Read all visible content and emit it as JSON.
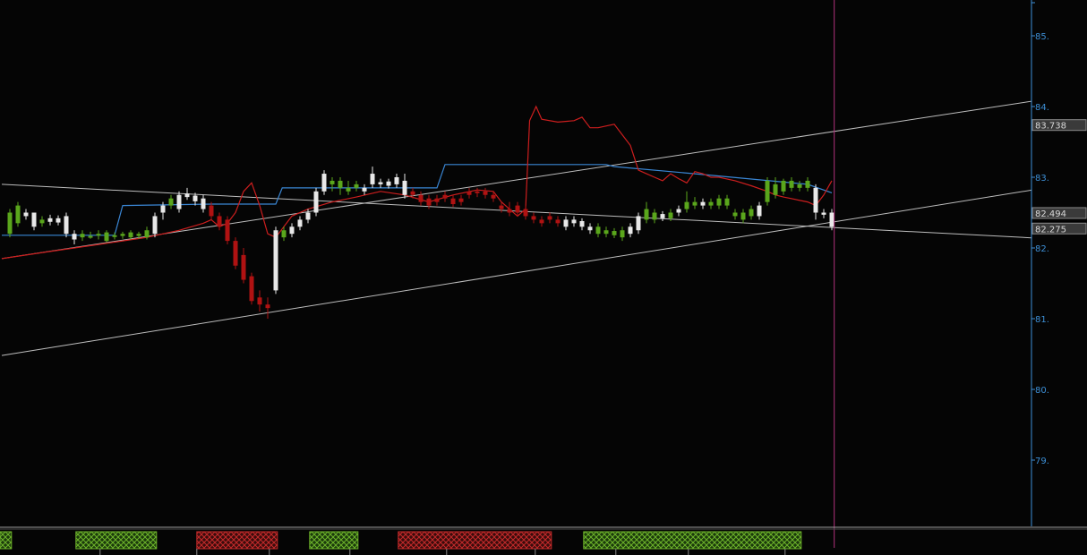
{
  "chart_data": {
    "type": "candlestick",
    "y_axis": {
      "side": "right",
      "ylim": [
        78.1,
        85.5
      ],
      "ticks": [
        {
          "value": 85,
          "label": "85."
        },
        {
          "value": 84,
          "label": "84."
        },
        {
          "value": 83,
          "label": "83."
        },
        {
          "value": 82,
          "label": "82."
        },
        {
          "value": 81,
          "label": "81."
        },
        {
          "value": 80,
          "label": "80."
        },
        {
          "value": 79,
          "label": "79."
        }
      ]
    },
    "grid": false,
    "colors": {
      "background": "#050505",
      "up_candle": "#5aa61c",
      "down_candle": "#b01212",
      "neutral_candle": "#e8e8e8",
      "red_line": "#cc1e1e",
      "blue_line": "#3a86d4",
      "trendline": "#bdbdbd",
      "cursor_line": "#b0307c",
      "axis_text": "#3d8fd6",
      "green_zone": "#6db32a",
      "red_zone": "#c42a2a"
    },
    "price_tags": [
      {
        "label": "83.738",
        "value": 83.738
      },
      {
        "label": "82.494",
        "value": 82.494
      },
      {
        "label": "82.3",
        "value": 82.3,
        "highlight": true
      },
      {
        "label": "82.275",
        "value": 82.275
      }
    ],
    "candles": [
      {
        "t": 1,
        "o": 82.2,
        "h": 82.55,
        "l": 82.15,
        "c": 82.5,
        "k": "g"
      },
      {
        "t": 2,
        "o": 82.6,
        "h": 82.65,
        "l": 82.3,
        "c": 82.35,
        "k": "g"
      },
      {
        "t": 3,
        "o": 82.5,
        "h": 82.55,
        "l": 82.4,
        "c": 82.45,
        "k": "w"
      },
      {
        "t": 4,
        "o": 82.3,
        "h": 82.5,
        "l": 82.25,
        "c": 82.5,
        "k": "w"
      },
      {
        "t": 5,
        "o": 82.35,
        "h": 82.45,
        "l": 82.3,
        "c": 82.4,
        "k": "g"
      },
      {
        "t": 6,
        "o": 82.37,
        "h": 82.47,
        "l": 82.32,
        "c": 82.42,
        "k": "w"
      },
      {
        "t": 7,
        "o": 82.36,
        "h": 82.46,
        "l": 82.32,
        "c": 82.42,
        "k": "w"
      },
      {
        "t": 8,
        "o": 82.2,
        "h": 82.5,
        "l": 82.15,
        "c": 82.45,
        "k": "w"
      },
      {
        "t": 9,
        "o": 82.2,
        "h": 82.25,
        "l": 82.05,
        "c": 82.12,
        "k": "w"
      },
      {
        "t": 10,
        "o": 82.15,
        "h": 82.25,
        "l": 82.1,
        "c": 82.2,
        "k": "g"
      },
      {
        "t": 11,
        "o": 82.17,
        "h": 82.23,
        "l": 82.13,
        "c": 82.17,
        "k": "g"
      },
      {
        "t": 12,
        "o": 82.18,
        "h": 82.25,
        "l": 82.12,
        "c": 82.2,
        "k": "g"
      },
      {
        "t": 13,
        "o": 82.1,
        "h": 82.25,
        "l": 82.08,
        "c": 82.22,
        "k": "g"
      },
      {
        "t": 14,
        "o": 82.16,
        "h": 82.22,
        "l": 82.12,
        "c": 82.18,
        "k": "g"
      },
      {
        "t": 15,
        "o": 82.17,
        "h": 82.23,
        "l": 82.13,
        "c": 82.2,
        "k": "g"
      },
      {
        "t": 16,
        "o": 82.15,
        "h": 82.25,
        "l": 82.12,
        "c": 82.22,
        "k": "g"
      },
      {
        "t": 17,
        "o": 82.17,
        "h": 82.23,
        "l": 82.13,
        "c": 82.2,
        "k": "g"
      },
      {
        "t": 18,
        "o": 82.15,
        "h": 82.3,
        "l": 82.12,
        "c": 82.25,
        "k": "g"
      },
      {
        "t": 19,
        "o": 82.2,
        "h": 82.5,
        "l": 82.15,
        "c": 82.45,
        "k": "w"
      },
      {
        "t": 20,
        "o": 82.5,
        "h": 82.65,
        "l": 82.4,
        "c": 82.6,
        "k": "w"
      },
      {
        "t": 21,
        "o": 82.6,
        "h": 82.75,
        "l": 82.55,
        "c": 82.7,
        "k": "g"
      },
      {
        "t": 22,
        "o": 82.55,
        "h": 82.8,
        "l": 82.5,
        "c": 82.75,
        "k": "w"
      },
      {
        "t": 23,
        "o": 82.72,
        "h": 82.85,
        "l": 82.68,
        "c": 82.77,
        "k": "w"
      },
      {
        "t": 24,
        "o": 82.74,
        "h": 82.78,
        "l": 82.6,
        "c": 82.66,
        "k": "w"
      },
      {
        "t": 25,
        "o": 82.7,
        "h": 82.75,
        "l": 82.5,
        "c": 82.55,
        "k": "w"
      },
      {
        "t": 26,
        "o": 82.6,
        "h": 82.65,
        "l": 82.4,
        "c": 82.45,
        "k": "r"
      },
      {
        "t": 27,
        "o": 82.45,
        "h": 82.5,
        "l": 82.25,
        "c": 82.3,
        "k": "r"
      },
      {
        "t": 28,
        "o": 82.4,
        "h": 82.45,
        "l": 82.05,
        "c": 82.1,
        "k": "r"
      },
      {
        "t": 29,
        "o": 82.1,
        "h": 82.15,
        "l": 81.7,
        "c": 81.75,
        "k": "r"
      },
      {
        "t": 30,
        "o": 81.9,
        "h": 82.0,
        "l": 81.5,
        "c": 81.55,
        "k": "r"
      },
      {
        "t": 31,
        "o": 81.6,
        "h": 81.65,
        "l": 81.2,
        "c": 81.25,
        "k": "r"
      },
      {
        "t": 32,
        "o": 81.3,
        "h": 81.4,
        "l": 81.1,
        "c": 81.2,
        "k": "r"
      },
      {
        "t": 33,
        "o": 81.2,
        "h": 81.3,
        "l": 81.0,
        "c": 81.15,
        "k": "r"
      },
      {
        "t": 34,
        "o": 81.4,
        "h": 82.3,
        "l": 81.35,
        "c": 82.25,
        "k": "w"
      },
      {
        "t": 35,
        "o": 82.15,
        "h": 82.3,
        "l": 82.1,
        "c": 82.25,
        "k": "g"
      },
      {
        "t": 36,
        "o": 82.2,
        "h": 82.35,
        "l": 82.15,
        "c": 82.3,
        "k": "w"
      },
      {
        "t": 37,
        "o": 82.3,
        "h": 82.45,
        "l": 82.25,
        "c": 82.4,
        "k": "w"
      },
      {
        "t": 38,
        "o": 82.4,
        "h": 82.55,
        "l": 82.35,
        "c": 82.5,
        "k": "w"
      },
      {
        "t": 39,
        "o": 82.5,
        "h": 82.85,
        "l": 82.45,
        "c": 82.8,
        "k": "w"
      },
      {
        "t": 40,
        "o": 82.8,
        "h": 83.1,
        "l": 82.75,
        "c": 83.05,
        "k": "w"
      },
      {
        "t": 41,
        "o": 82.9,
        "h": 83.0,
        "l": 82.8,
        "c": 82.95,
        "k": "g"
      },
      {
        "t": 42,
        "o": 82.85,
        "h": 83.0,
        "l": 82.75,
        "c": 82.95,
        "k": "g"
      },
      {
        "t": 43,
        "o": 82.8,
        "h": 82.95,
        "l": 82.75,
        "c": 82.85,
        "k": "g"
      },
      {
        "t": 44,
        "o": 82.85,
        "h": 82.95,
        "l": 82.8,
        "c": 82.9,
        "k": "g"
      },
      {
        "t": 45,
        "o": 82.8,
        "h": 82.9,
        "l": 82.75,
        "c": 82.85,
        "k": "w"
      },
      {
        "t": 46,
        "o": 82.9,
        "h": 83.15,
        "l": 82.85,
        "c": 83.05,
        "k": "w"
      },
      {
        "t": 47,
        "o": 82.9,
        "h": 82.98,
        "l": 82.85,
        "c": 82.93,
        "k": "w"
      },
      {
        "t": 48,
        "o": 82.88,
        "h": 82.98,
        "l": 82.84,
        "c": 82.94,
        "k": "w"
      },
      {
        "t": 49,
        "o": 82.9,
        "h": 83.05,
        "l": 82.85,
        "c": 83.0,
        "k": "w"
      },
      {
        "t": 50,
        "o": 82.95,
        "h": 83.05,
        "l": 82.7,
        "c": 82.75,
        "k": "w"
      },
      {
        "t": 51,
        "o": 82.8,
        "h": 82.85,
        "l": 82.7,
        "c": 82.75,
        "k": "r"
      },
      {
        "t": 52,
        "o": 82.75,
        "h": 82.8,
        "l": 82.6,
        "c": 82.65,
        "k": "r"
      },
      {
        "t": 53,
        "o": 82.7,
        "h": 82.75,
        "l": 82.55,
        "c": 82.6,
        "k": "r"
      },
      {
        "t": 54,
        "o": 82.7,
        "h": 82.75,
        "l": 82.6,
        "c": 82.65,
        "k": "r"
      },
      {
        "t": 55,
        "o": 82.75,
        "h": 82.8,
        "l": 82.65,
        "c": 82.7,
        "k": "r"
      },
      {
        "t": 56,
        "o": 82.7,
        "h": 82.75,
        "l": 82.58,
        "c": 82.62,
        "k": "r"
      },
      {
        "t": 57,
        "o": 82.65,
        "h": 82.75,
        "l": 82.6,
        "c": 82.7,
        "k": "r"
      },
      {
        "t": 58,
        "o": 82.75,
        "h": 82.85,
        "l": 82.7,
        "c": 82.8,
        "k": "r"
      },
      {
        "t": 59,
        "o": 82.78,
        "h": 82.85,
        "l": 82.72,
        "c": 82.8,
        "k": "r"
      },
      {
        "t": 60,
        "o": 82.8,
        "h": 82.85,
        "l": 82.7,
        "c": 82.75,
        "k": "r"
      },
      {
        "t": 61,
        "o": 82.75,
        "h": 82.8,
        "l": 82.65,
        "c": 82.7,
        "k": "r"
      },
      {
        "t": 62,
        "o": 82.6,
        "h": 82.65,
        "l": 82.5,
        "c": 82.55,
        "k": "r"
      },
      {
        "t": 63,
        "o": 82.55,
        "h": 82.65,
        "l": 82.45,
        "c": 82.5,
        "k": "r"
      },
      {
        "t": 64,
        "o": 82.6,
        "h": 82.65,
        "l": 82.45,
        "c": 82.5,
        "k": "r"
      },
      {
        "t": 65,
        "o": 82.55,
        "h": 82.6,
        "l": 82.4,
        "c": 82.45,
        "k": "r"
      },
      {
        "t": 66,
        "o": 82.45,
        "h": 82.5,
        "l": 82.35,
        "c": 82.4,
        "k": "r"
      },
      {
        "t": 67,
        "o": 82.4,
        "h": 82.45,
        "l": 82.3,
        "c": 82.35,
        "k": "r"
      },
      {
        "t": 68,
        "o": 82.4,
        "h": 82.5,
        "l": 82.35,
        "c": 82.45,
        "k": "r"
      },
      {
        "t": 69,
        "o": 82.35,
        "h": 82.45,
        "l": 82.3,
        "c": 82.4,
        "k": "r"
      },
      {
        "t": 70,
        "o": 82.3,
        "h": 82.45,
        "l": 82.25,
        "c": 82.4,
        "k": "w"
      },
      {
        "t": 71,
        "o": 82.35,
        "h": 82.45,
        "l": 82.3,
        "c": 82.4,
        "k": "w"
      },
      {
        "t": 72,
        "o": 82.3,
        "h": 82.42,
        "l": 82.25,
        "c": 82.38,
        "k": "w"
      },
      {
        "t": 73,
        "o": 82.25,
        "h": 82.35,
        "l": 82.2,
        "c": 82.3,
        "k": "w"
      },
      {
        "t": 74,
        "o": 82.3,
        "h": 82.35,
        "l": 82.15,
        "c": 82.2,
        "k": "g"
      },
      {
        "t": 75,
        "o": 82.2,
        "h": 82.3,
        "l": 82.15,
        "c": 82.25,
        "k": "g"
      },
      {
        "t": 76,
        "o": 82.18,
        "h": 82.28,
        "l": 82.14,
        "c": 82.24,
        "k": "g"
      },
      {
        "t": 77,
        "o": 82.15,
        "h": 82.3,
        "l": 82.1,
        "c": 82.25,
        "k": "g"
      },
      {
        "t": 78,
        "o": 82.2,
        "h": 82.35,
        "l": 82.15,
        "c": 82.3,
        "k": "w"
      },
      {
        "t": 79,
        "o": 82.25,
        "h": 82.5,
        "l": 82.2,
        "c": 82.45,
        "k": "w"
      },
      {
        "t": 80,
        "o": 82.4,
        "h": 82.65,
        "l": 82.35,
        "c": 82.55,
        "k": "g"
      },
      {
        "t": 81,
        "o": 82.4,
        "h": 82.55,
        "l": 82.35,
        "c": 82.5,
        "k": "g"
      },
      {
        "t": 82,
        "o": 82.42,
        "h": 82.52,
        "l": 82.38,
        "c": 82.48,
        "k": "w"
      },
      {
        "t": 83,
        "o": 82.42,
        "h": 82.55,
        "l": 82.38,
        "c": 82.5,
        "k": "g"
      },
      {
        "t": 84,
        "o": 82.5,
        "h": 82.6,
        "l": 82.45,
        "c": 82.55,
        "k": "w"
      },
      {
        "t": 85,
        "o": 82.55,
        "h": 82.8,
        "l": 82.5,
        "c": 82.65,
        "k": "g"
      },
      {
        "t": 86,
        "o": 82.6,
        "h": 82.72,
        "l": 82.55,
        "c": 82.65,
        "k": "g"
      },
      {
        "t": 87,
        "o": 82.6,
        "h": 82.7,
        "l": 82.55,
        "c": 82.65,
        "k": "w"
      },
      {
        "t": 88,
        "o": 82.6,
        "h": 82.7,
        "l": 82.55,
        "c": 82.65,
        "k": "g"
      },
      {
        "t": 89,
        "o": 82.6,
        "h": 82.75,
        "l": 82.55,
        "c": 82.7,
        "k": "g"
      },
      {
        "t": 90,
        "o": 82.7,
        "h": 82.75,
        "l": 82.55,
        "c": 82.6,
        "k": "g"
      },
      {
        "t": 91,
        "o": 82.5,
        "h": 82.55,
        "l": 82.4,
        "c": 82.45,
        "k": "g"
      },
      {
        "t": 92,
        "o": 82.4,
        "h": 82.55,
        "l": 82.35,
        "c": 82.5,
        "k": "g"
      },
      {
        "t": 93,
        "o": 82.45,
        "h": 82.6,
        "l": 82.4,
        "c": 82.55,
        "k": "g"
      },
      {
        "t": 94,
        "o": 82.45,
        "h": 82.65,
        "l": 82.4,
        "c": 82.6,
        "k": "w"
      },
      {
        "t": 95,
        "o": 82.65,
        "h": 83.0,
        "l": 82.6,
        "c": 82.95,
        "k": "g"
      },
      {
        "t": 96,
        "o": 82.9,
        "h": 83.0,
        "l": 82.7,
        "c": 82.75,
        "k": "g"
      },
      {
        "t": 97,
        "o": 82.8,
        "h": 82.98,
        "l": 82.75,
        "c": 82.95,
        "k": "g"
      },
      {
        "t": 98,
        "o": 82.95,
        "h": 83.0,
        "l": 82.8,
        "c": 82.85,
        "k": "g"
      },
      {
        "t": 99,
        "o": 82.85,
        "h": 82.95,
        "l": 82.8,
        "c": 82.9,
        "k": "g"
      },
      {
        "t": 100,
        "o": 82.95,
        "h": 83.0,
        "l": 82.8,
        "c": 82.85,
        "k": "g"
      },
      {
        "t": 101,
        "o": 82.85,
        "h": 82.9,
        "l": 82.4,
        "c": 82.5,
        "k": "w"
      },
      {
        "t": 102,
        "o": 82.5,
        "h": 82.55,
        "l": 82.42,
        "c": 82.47,
        "k": "w"
      },
      {
        "t": 103,
        "o": 82.5,
        "h": 82.55,
        "l": 82.25,
        "c": 82.3,
        "k": "w"
      }
    ],
    "red_line": [
      [
        0,
        81.85
      ],
      [
        6,
        81.95
      ],
      [
        12,
        82.05
      ],
      [
        18,
        82.15
      ],
      [
        22,
        82.25
      ],
      [
        25,
        82.35
      ],
      [
        26,
        82.4
      ],
      [
        27,
        82.3
      ],
      [
        28,
        82.35
      ],
      [
        29,
        82.5
      ],
      [
        30,
        82.8
      ],
      [
        31,
        82.92
      ],
      [
        32,
        82.6
      ],
      [
        33,
        82.2
      ],
      [
        34,
        82.15
      ],
      [
        35,
        82.3
      ],
      [
        36,
        82.45
      ],
      [
        38,
        82.55
      ],
      [
        41,
        82.65
      ],
      [
        44,
        82.72
      ],
      [
        47,
        82.8
      ],
      [
        50,
        82.75
      ],
      [
        53,
        82.65
      ],
      [
        56,
        82.75
      ],
      [
        59,
        82.82
      ],
      [
        61,
        82.8
      ],
      [
        62,
        82.65
      ],
      [
        63,
        82.55
      ],
      [
        64,
        82.45
      ],
      [
        65,
        82.55
      ],
      [
        65.5,
        83.8
      ],
      [
        66.3,
        84.0
      ],
      [
        67,
        83.82
      ],
      [
        69,
        83.78
      ],
      [
        71,
        83.8
      ],
      [
        72,
        83.85
      ],
      [
        73,
        83.7
      ],
      [
        74,
        83.7
      ],
      [
        76,
        83.75
      ],
      [
        77,
        83.6
      ],
      [
        78,
        83.45
      ],
      [
        79,
        83.1
      ],
      [
        80,
        83.05
      ],
      [
        81,
        83.0
      ],
      [
        82,
        82.95
      ],
      [
        83,
        83.05
      ],
      [
        84,
        82.98
      ],
      [
        85,
        82.92
      ],
      [
        86,
        83.08
      ],
      [
        87,
        83.05
      ],
      [
        88,
        83.0
      ],
      [
        89,
        83.0
      ],
      [
        91,
        82.95
      ],
      [
        93,
        82.88
      ],
      [
        95,
        82.8
      ],
      [
        96,
        82.75
      ],
      [
        97,
        82.72
      ],
      [
        100,
        82.65
      ],
      [
        101,
        82.6
      ],
      [
        102,
        82.75
      ],
      [
        103,
        82.95
      ]
    ],
    "blue_line": [
      [
        0,
        82.18
      ],
      [
        14,
        82.18
      ],
      [
        15,
        82.6
      ],
      [
        26,
        82.62
      ],
      [
        34,
        82.62
      ],
      [
        34.8,
        82.85
      ],
      [
        54,
        82.85
      ],
      [
        55,
        83.18
      ],
      [
        75,
        83.18
      ],
      [
        76,
        83.15
      ],
      [
        86,
        83.05
      ],
      [
        100,
        82.9
      ],
      [
        103,
        82.78
      ]
    ],
    "trendlines": [
      {
        "from": [
          0,
          82.9
        ],
        "to": [
          135,
          82.1
        ]
      },
      {
        "from": [
          0,
          81.85
        ],
        "to": [
          135,
          84.2
        ]
      },
      {
        "from": [
          0,
          80.48
        ],
        "to": [
          135,
          82.95
        ]
      }
    ],
    "cursor_t": 103.3,
    "zones": [
      {
        "from": -3,
        "to": 1.2,
        "color": "green"
      },
      {
        "from": 9.2,
        "to": 19.2,
        "color": "green"
      },
      {
        "from": 24.2,
        "to": 34.2,
        "color": "red"
      },
      {
        "from": 38.2,
        "to": 44.2,
        "color": "green"
      },
      {
        "from": 49.2,
        "to": 68.2,
        "color": "red"
      },
      {
        "from": 72.2,
        "to": 99.2,
        "color": "green"
      }
    ],
    "zone_ticks": [
      12.2,
      24.2,
      33.2,
      43.2,
      55.2,
      66.2,
      76.2,
      85.2,
      97.2
    ]
  }
}
